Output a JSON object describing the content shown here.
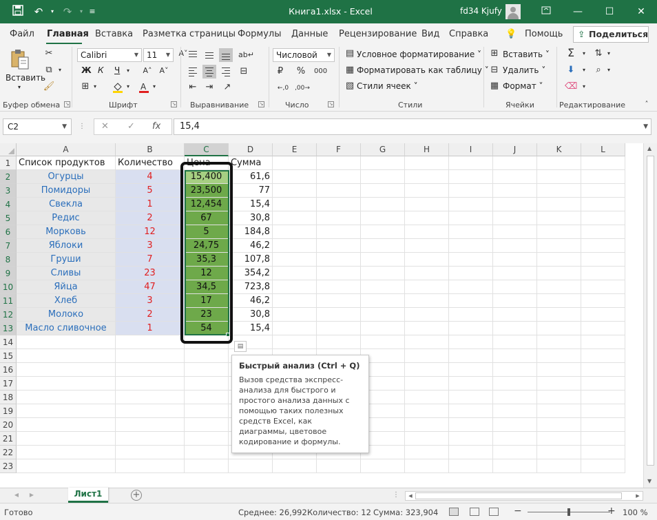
{
  "title_bar": {
    "doc_title": "Книга1.xlsx  -  Excel",
    "user_name": "fd34 Kjufy",
    "icons": [
      "save-icon",
      "undo-icon",
      "redo-icon",
      "customize-icon"
    ]
  },
  "menu": {
    "tabs": [
      "Файл",
      "Главная",
      "Вставка",
      "Разметка страницы",
      "Формулы",
      "Данные",
      "Рецензирование",
      "Вид",
      "Справка",
      "Помощь"
    ],
    "active_tab": "Главная",
    "share": "Поделиться"
  },
  "ribbon": {
    "paste": "Вставить",
    "font_name": "Calibri",
    "font_size": "11",
    "number_format": "Числовой",
    "cond_format": "Условное форматирование",
    "format_table": "Форматировать как таблицу",
    "cell_styles": "Стили ячеек",
    "insert": "Вставить",
    "delete": "Удалить",
    "format": "Формат",
    "groups": {
      "clipboard": "Буфер обмена",
      "font": "Шрифт",
      "alignment": "Выравнивание",
      "number": "Число",
      "styles": "Стили",
      "cells": "Ячейки",
      "editing": "Редактирование"
    },
    "bold": "Ж",
    "italic": "К",
    "underline": "Ч"
  },
  "formula_bar": {
    "name_box": "C2",
    "fx": "fx",
    "value": "15,4"
  },
  "sheet": {
    "columns": [
      "A",
      "B",
      "C",
      "D",
      "E",
      "F",
      "G",
      "H",
      "I",
      "J",
      "K",
      "L"
    ],
    "rows": [
      "1",
      "2",
      "3",
      "4",
      "5",
      "6",
      "7",
      "8",
      "9",
      "10",
      "11",
      "12",
      "13",
      "14",
      "15",
      "16",
      "17",
      "18",
      "19",
      "20",
      "21",
      "22",
      "23"
    ],
    "header_row": {
      "a": "Список продуктов",
      "b": "Количество",
      "c": "Цена",
      "d": "Сумма"
    },
    "data": [
      {
        "a": "Огурцы",
        "b": "4",
        "c": "15,400",
        "d": "61,6"
      },
      {
        "a": "Помидоры",
        "b": "5",
        "c": "23,500",
        "d": "77"
      },
      {
        "a": "Свекла",
        "b": "1",
        "c": "12,454",
        "d": "15,4"
      },
      {
        "a": "Редис",
        "b": "2",
        "c": "67",
        "d": "30,8"
      },
      {
        "a": "Морковь",
        "b": "12",
        "c": "5",
        "d": "184,8"
      },
      {
        "a": "Яблоки",
        "b": "3",
        "c": "24,75",
        "d": "46,2"
      },
      {
        "a": "Груши",
        "b": "7",
        "c": "35,3",
        "d": "107,8"
      },
      {
        "a": "Сливы",
        "b": "23",
        "c": "12",
        "d": "354,2"
      },
      {
        "a": "Яйца",
        "b": "47",
        "c": "34,5",
        "d": "723,8"
      },
      {
        "a": "Хлеб",
        "b": "3",
        "c": "17",
        "d": "46,2"
      },
      {
        "a": "Молоко",
        "b": "2",
        "c": "23",
        "d": "30,8"
      },
      {
        "a": "Масло сливочное",
        "b": "1",
        "c": "54",
        "d": "15,4"
      }
    ],
    "colors": {
      "col_a_fill": "#e8e8e8",
      "col_a_text": "#2a6ebb",
      "col_b_fill": "#d9dff0",
      "col_b_text": "#e02020",
      "col_c_fill": "#6ea94a"
    }
  },
  "tooltip": {
    "title": "Быстрый анализ (Ctrl + Q)",
    "body": "Вызов средства экспресс-анализа для быстрого и простого анализа данных с помощью таких полезных средств Excel, как диаграммы, цветовое кодирование и формулы."
  },
  "sheet_tab": "Лист1",
  "status": {
    "ready": "Готово",
    "average": "Среднее: 26,992",
    "count": "Количество: 12",
    "sum": "Сумма: 323,904",
    "zoom": "100 %"
  },
  "accent_color": "#1f7245"
}
